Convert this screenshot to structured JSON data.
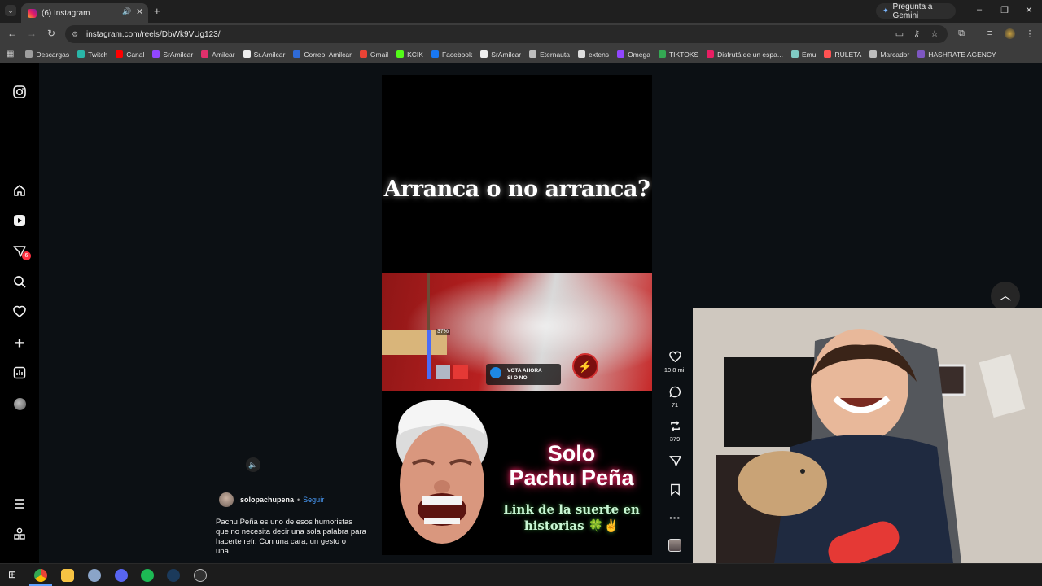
{
  "browser": {
    "tab_title": "(6) Instagram",
    "gemini_label": "Pregunta a Gemini",
    "url": "instagram.com/reels/DbWk9VUg123/",
    "tab_audio_icon": "speaker-icon",
    "tab_close_icon": "close-icon",
    "new_tab_icon": "plus-icon"
  },
  "bookmarks": [
    {
      "label": "Descargas",
      "color": "#9e9e9e"
    },
    {
      "label": "Twitch",
      "color": "#29b6a8"
    },
    {
      "label": "Canal",
      "color": "#ff0000"
    },
    {
      "label": "SrAmilcar",
      "color": "#9146ff"
    },
    {
      "label": "Amilcar",
      "color": "#e1306c"
    },
    {
      "label": "Sr.Amilcar",
      "color": "#eeeeee"
    },
    {
      "label": "Correo: Amilcar",
      "color": "#2f6bd8"
    },
    {
      "label": "Gmail",
      "color": "#ea4335"
    },
    {
      "label": "KCIK",
      "color": "#53fc18"
    },
    {
      "label": "Facebook",
      "color": "#1877f2"
    },
    {
      "label": "SrAmilcar",
      "color": "#eeeeee"
    },
    {
      "label": "Eternauta",
      "color": "#bdbdbd"
    },
    {
      "label": "extens",
      "color": "#dddddd"
    },
    {
      "label": "Omega",
      "color": "#9146ff"
    },
    {
      "label": "TIKTOKS",
      "color": "#34a853"
    },
    {
      "label": "Disfrutá de un espa...",
      "color": "#e91e63"
    },
    {
      "label": "Emu",
      "color": "#80cbc4"
    },
    {
      "label": "RULETA",
      "color": "#ff5252"
    },
    {
      "label": "Marcador",
      "color": "#bdbdbd"
    },
    {
      "label": "HASHRATE AGENCY",
      "color": "#7e57c2"
    }
  ],
  "sidebar": {
    "notification_count": "6"
  },
  "reel": {
    "title": "Arranca o no arranca?",
    "clip_overlay": "VOTA AHORA SI O NO",
    "clip_percent": "37%",
    "headline_line1": "Solo",
    "headline_line2": "Pachu Peña",
    "link_line1": "Link de la suerte en",
    "link_line2": "historias 🍀✌"
  },
  "author": {
    "username": "solopachupena",
    "separator": "•",
    "follow_label": "Seguir",
    "caption": "Pachu Peña es uno de esos humoristas que no necesita decir una sola palabra para hacerte reír. Con una cara, un gesto o una..."
  },
  "actions": {
    "likes": "10,8 mil",
    "comments": "71",
    "reposts": "379"
  }
}
